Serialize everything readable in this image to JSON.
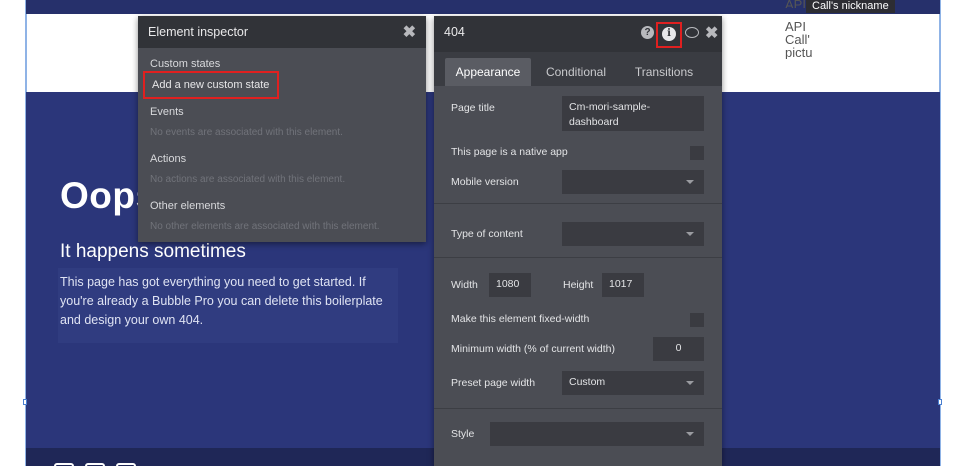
{
  "canvas": {
    "api_top_fragment": "API",
    "nickname_tooltip": "Call's nickname",
    "api_side_lines": [
      "API",
      "Call'",
      "pictu"
    ],
    "heading": "Oops",
    "subheading": "It happens sometimes",
    "body": "This page has got everything you need to get started. If you're already a Bubble Pro you can delete this boilerplate and design your own 404."
  },
  "inspector": {
    "title": "Element inspector",
    "sections": {
      "custom_states": "Custom states",
      "add_custom_state": "Add a new custom state",
      "events": "Events",
      "events_empty": "No events are associated with this element.",
      "actions": "Actions",
      "actions_empty": "No actions are associated with this element.",
      "other_elements": "Other elements",
      "other_empty": "No other elements are associated with this element."
    }
  },
  "editor": {
    "title": "404",
    "tabs": [
      "Appearance",
      "Conditional",
      "Transitions"
    ],
    "active_tab": "Appearance",
    "page_title_label": "Page title",
    "page_title_value": "Cm-mori-sample-dashboard",
    "native_app_label": "This page is a native app",
    "mobile_version_label": "Mobile version",
    "mobile_version_value": "",
    "type_of_content_label": "Type of content",
    "type_of_content_value": "",
    "width_label": "Width",
    "width_value": "1080",
    "height_label": "Height",
    "height_value": "1017",
    "fixed_width_label": "Make this element fixed-width",
    "min_width_label": "Minimum width (% of current width)",
    "min_width_value": "0",
    "preset_label": "Preset page width",
    "preset_value": "Custom",
    "style_label": "Style",
    "style_value": ""
  },
  "colors": {
    "page_blue": "#2b367a",
    "panel": "#4b4d54",
    "panel_header": "#313338",
    "highlight": "#e02020"
  }
}
